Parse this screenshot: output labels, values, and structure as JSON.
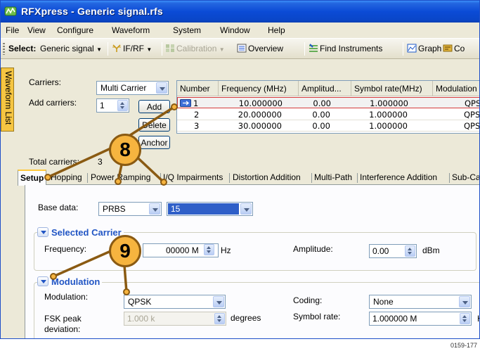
{
  "window": {
    "title": "RFXpress - Generic signal.rfs"
  },
  "menu": [
    "File",
    "View",
    "Configure",
    "Waveform",
    "System",
    "Window",
    "Help"
  ],
  "toolbar": {
    "select_label": "Select:",
    "select_value": "Generic signal",
    "if_rf_label": "IF/RF",
    "calibration_label": "Calibration",
    "overview_label": "Overview",
    "find_instruments_label": "Find Instruments",
    "graph_label": "Graph",
    "clipped_label": "Co"
  },
  "side_tab": {
    "label": "Waveform List"
  },
  "carriers": {
    "carriers_label": "Carriers:",
    "carriers_value": "Multi Carrier",
    "add_carriers_label": "Add carriers:",
    "add_count": "1",
    "add_button": "Add",
    "delete_button": "Delete",
    "anchor_button": "Anchor",
    "total_label": "Total carriers:",
    "total_value": "3"
  },
  "carrier_table": {
    "columns": [
      "Number",
      "Frequency (MHz)",
      "Amplitud...",
      "Symbol rate(MHz)",
      "Modulation"
    ],
    "rows": [
      {
        "number": "1",
        "frequency": "10.000000",
        "amplitude": "0.00",
        "symbol_rate": "1.000000",
        "modulation": "QPS"
      },
      {
        "number": "2",
        "frequency": "20.000000",
        "amplitude": "0.00",
        "symbol_rate": "1.000000",
        "modulation": "QPS"
      },
      {
        "number": "3",
        "frequency": "30.000000",
        "amplitude": "0.00",
        "symbol_rate": "1.000000",
        "modulation": "QPS"
      }
    ]
  },
  "tabs": [
    "Setup",
    "Hopping",
    "Power Ramping",
    "I/Q Impairments",
    "Distortion Addition",
    "Multi-Path",
    "Interference Addition",
    "Sub-Carri"
  ],
  "setup": {
    "base_data_label": "Base data:",
    "base_data_value": "PRBS",
    "prbs_order_value": "15",
    "selected_carrier": {
      "title": "Selected Carrier",
      "frequency_label": "Frequency:",
      "frequency_value": "00000 M",
      "frequency_unit": "Hz",
      "amplitude_label": "Amplitude:",
      "amplitude_value": "0.00",
      "amplitude_unit": "dBm"
    },
    "modulation_group": {
      "title": "Modulation",
      "modulation_label": "Modulation:",
      "modulation_value": "QPSK",
      "coding_label": "Coding:",
      "coding_value": "None",
      "fsk_label_line1": "FSK peak",
      "fsk_label_line2": "deviation:",
      "fsk_value": "1.000 k",
      "fsk_unit": "degrees",
      "symbol_rate_label": "Symbol rate:",
      "symbol_rate_value": "1.000000 M",
      "symbol_rate_unit": "Hz"
    }
  },
  "callouts": [
    "8",
    "9"
  ],
  "figure_id": "0159-177",
  "colors": {
    "title_bar": "#0b4bd6",
    "selection_highlight": "#2f5fc8",
    "callout_fill": "#f6b43f",
    "callout_line": "#8a5a12",
    "group_title": "#2155c4"
  }
}
